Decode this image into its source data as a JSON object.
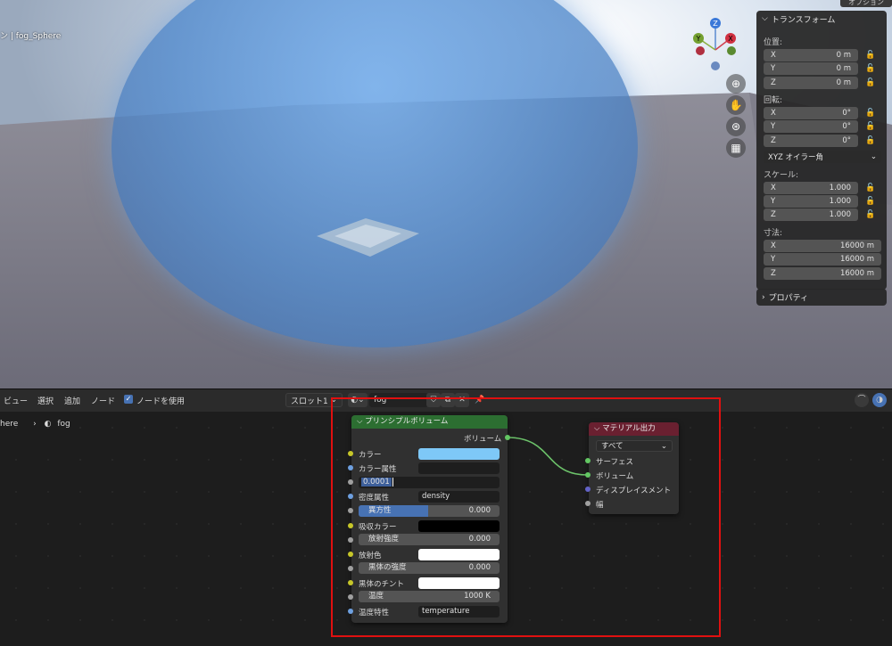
{
  "viewport": {
    "object_title": "ン | fog_Sphere",
    "gizmo_axes": [
      "Z",
      "Y",
      "X"
    ],
    "options_tab": "オプション"
  },
  "transform_panel": {
    "title": "トランスフォーム",
    "location_label": "位置:",
    "location": [
      {
        "axis": "X",
        "value": "0 m"
      },
      {
        "axis": "Y",
        "value": "0 m"
      },
      {
        "axis": "Z",
        "value": "0 m"
      }
    ],
    "rotation_label": "回転:",
    "rotation": [
      {
        "axis": "X",
        "value": "0°"
      },
      {
        "axis": "Y",
        "value": "0°"
      },
      {
        "axis": "Z",
        "value": "0°"
      }
    ],
    "rotation_mode": "XYZ オイラー角",
    "scale_label": "スケール:",
    "scale": [
      {
        "axis": "X",
        "value": "1.000"
      },
      {
        "axis": "Y",
        "value": "1.000"
      },
      {
        "axis": "Z",
        "value": "1.000"
      }
    ],
    "dimensions_label": "寸法:",
    "dimensions": [
      {
        "axis": "X",
        "value": "16000 m"
      },
      {
        "axis": "Y",
        "value": "16000 m"
      },
      {
        "axis": "Z",
        "value": "16000 m"
      }
    ],
    "properties_title": "プロパティ"
  },
  "node_header": {
    "menus": [
      "ビュー",
      "選択",
      "追加",
      "ノード"
    ],
    "use_nodes_label": "ノードを使用",
    "slot": "スロット1",
    "material_name": "fog",
    "breadcrumb": [
      "here",
      "fog"
    ]
  },
  "principled_volume": {
    "title": "プリンシプルボリューム",
    "output_label": "ボリューム",
    "inputs": [
      {
        "label": "カラー",
        "value": ""
      },
      {
        "label": "カラー属性",
        "value": ""
      },
      {
        "label": "",
        "value": "0.0001"
      },
      {
        "label": "密度属性",
        "value": "density"
      },
      {
        "label": "異方性",
        "value": "0.000"
      },
      {
        "label": "吸収カラー",
        "value": ""
      },
      {
        "label": "放射強度",
        "value": "0.000"
      },
      {
        "label": "放射色",
        "value": ""
      },
      {
        "label": "黒体の強度",
        "value": "0.000"
      },
      {
        "label": "黒体のチント",
        "value": ""
      },
      {
        "label": "温度",
        "value": "1000 K"
      },
      {
        "label": "温度特性",
        "value": "temperature"
      }
    ],
    "colors": {
      "color": "#7ec8f7",
      "absorption": "#000000",
      "emission": "#ffffff",
      "tint": "#ffffff"
    }
  },
  "material_output": {
    "title": "マテリアル出力",
    "target": "すべて",
    "inputs": [
      "サーフェス",
      "ボリューム",
      "ディスプレイスメント",
      "幅"
    ]
  }
}
